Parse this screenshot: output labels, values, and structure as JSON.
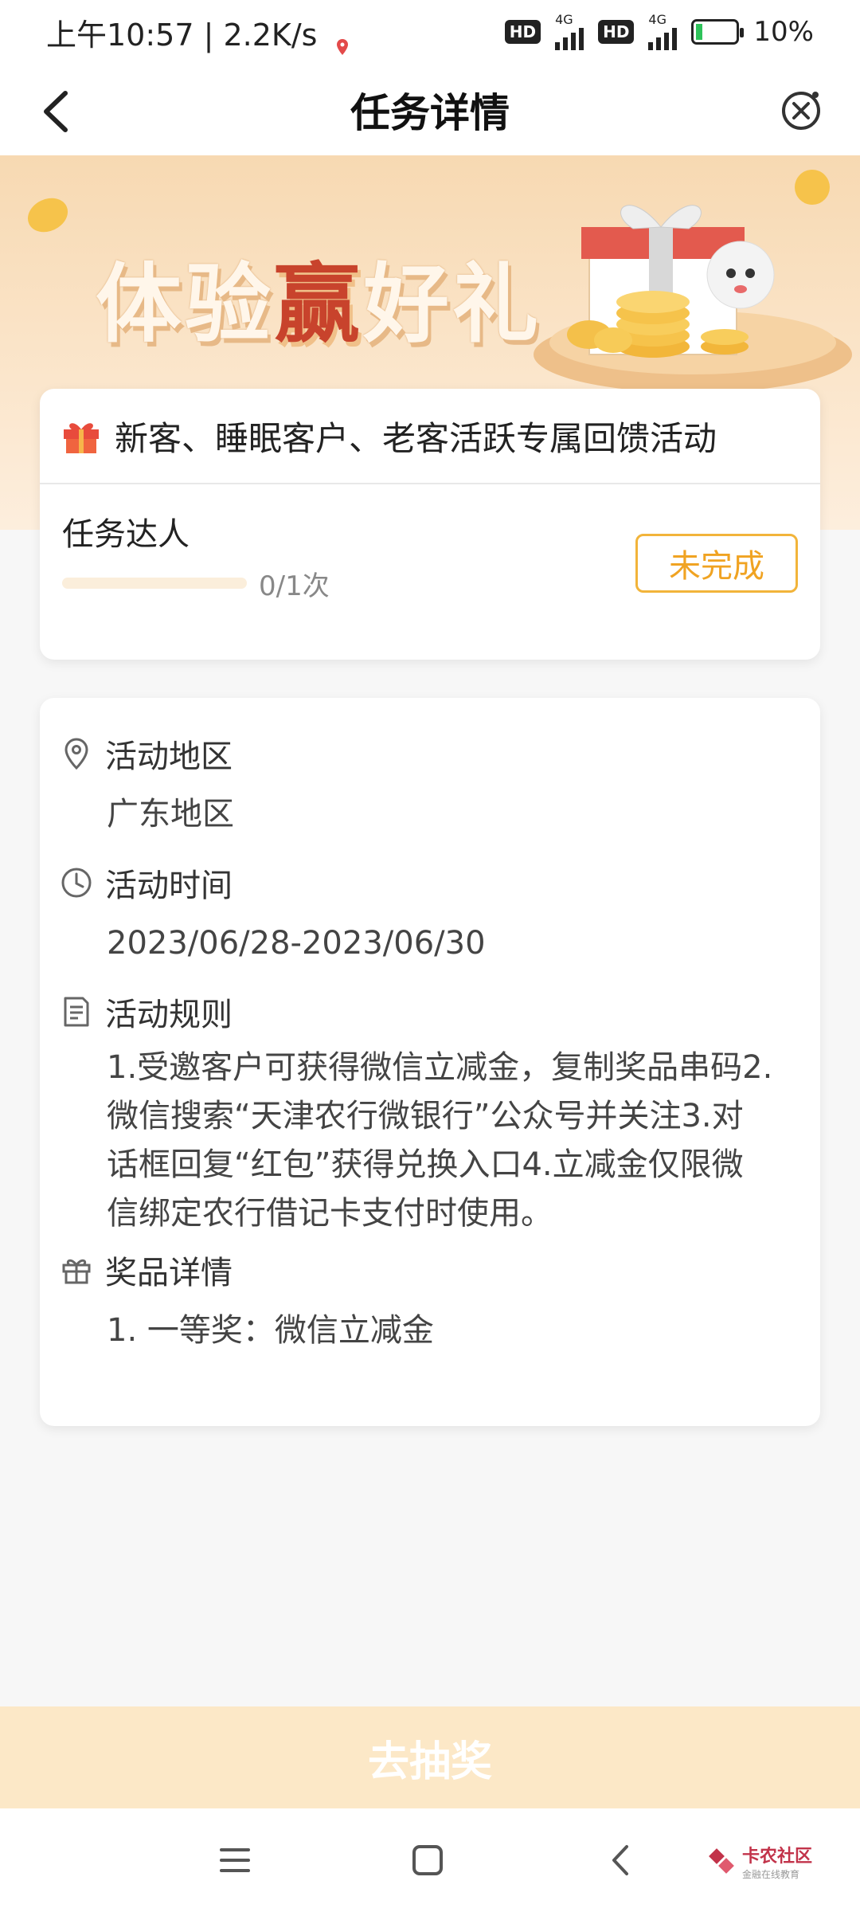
{
  "status_bar": {
    "time": "上午10:57",
    "speed": "2.2K/s",
    "hd1": "HD",
    "net1": "4G",
    "hd2": "HD",
    "net2": "4G",
    "battery": "10%"
  },
  "nav": {
    "title": "任务详情"
  },
  "banner": {
    "slogan_part1": "体验",
    "slogan_highlight": "赢",
    "slogan_part2": "好礼"
  },
  "task_card": {
    "title": "新客、睡眠客户、老客活跃专属回馈活动",
    "task_name": "任务达人",
    "progress_text": "0/1次",
    "progress_fraction": 0,
    "status_button": "未完成"
  },
  "info_card": {
    "region_label": "活动地区",
    "region_value": "广东地区",
    "time_label": "活动时间",
    "time_value": "2023/06/28-2023/06/30",
    "rules_label": "活动规则",
    "rules_lines": [
      "1.受邀客户可获得微信立减金，复制奖品串码2.",
      "微信搜索“天津农行微银行”公众号并关注3.对",
      "话框回复“红包”获得兑换入口4.立减金仅限微",
      "信绑定农行借记卡支付时使用。"
    ],
    "prize_label": "奖品详情",
    "prize_value": "1. 一等奖：微信立减金"
  },
  "cta": {
    "label": "去抽奖"
  },
  "watermark": {
    "brand": "卡农社区",
    "tagline": "金融在线教育"
  },
  "colors": {
    "accent": "#f0a322",
    "banner_bg": "#f7d9b2",
    "cta_bg": "#fce8c7"
  }
}
